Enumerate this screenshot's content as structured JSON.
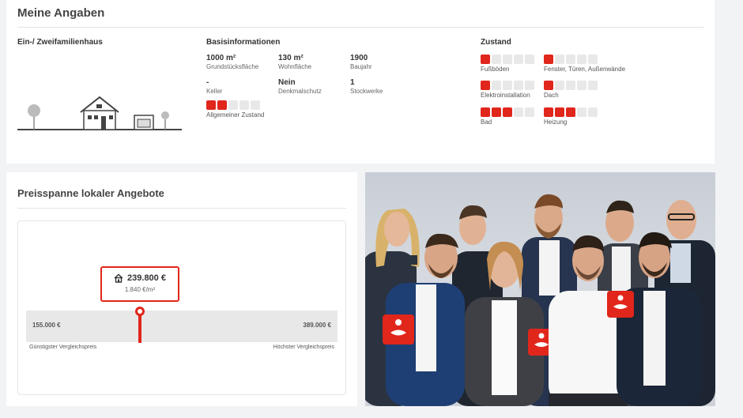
{
  "card1": {
    "title": "Meine Angaben",
    "house_type": "Ein-/ Zweifamilienhaus",
    "basis_title": "Basisinformationen",
    "basis": [
      {
        "value": "1000 m²",
        "label": "Grundstücksfläche"
      },
      {
        "value": "130 m²",
        "label": "Wohnfläche"
      },
      {
        "value": "1900",
        "label": "Baujahr"
      },
      {
        "value": "-",
        "label": "Keller"
      },
      {
        "value": "Nein",
        "label": "Denkmalschutz"
      },
      {
        "value": "1",
        "label": "Stockwerke"
      }
    ],
    "overall_label": "Allgemeiner Zustand",
    "overall_level": 2,
    "zustand_title": "Zustand",
    "zustand": [
      {
        "label": "Fußböden",
        "level": 1
      },
      {
        "label": "Fenster, Türen, Außenwände",
        "level": 1
      },
      {
        "label": "Elektroinstallation",
        "level": 1
      },
      {
        "label": "Dach",
        "level": 1
      },
      {
        "label": "Bad",
        "level": 3
      },
      {
        "label": "Heizung",
        "level": 3
      }
    ]
  },
  "card2": {
    "title": "Preisspanne lokaler Angebote",
    "price": "239.800 €",
    "price_per_m2": "1.840 €/m²",
    "low": "155.000 €",
    "high": "389.000 €",
    "low_caption": "Günstigster Vergleichspreis",
    "high_caption": "Höchster Vergleichspreis"
  },
  "colors": {
    "accent": "#e1261c",
    "inactive": "#e8e8e8"
  }
}
